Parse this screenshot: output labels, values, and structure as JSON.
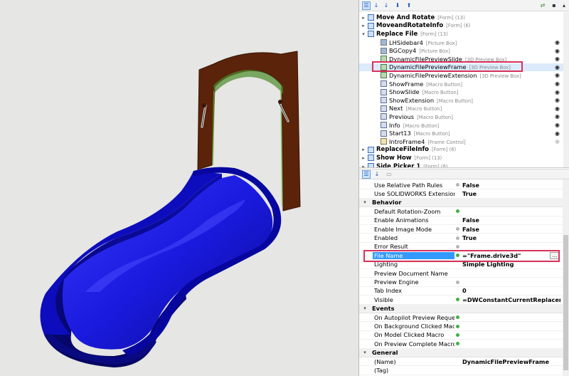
{
  "tree": {
    "rows": [
      {
        "label": "Move And Rotate",
        "type": "[Form] (13)",
        "level": 0,
        "exp": "▸",
        "icon": "form-icon",
        "bold": true
      },
      {
        "label": "MoveandRotateInfo",
        "type": "[Form] (6)",
        "level": 0,
        "exp": "▸",
        "icon": "form-icon",
        "bold": true
      },
      {
        "label": "Replace File",
        "type": "[Form] (13)",
        "level": 0,
        "exp": "▾",
        "icon": "form-icon",
        "bold": true
      },
      {
        "label": "LHSidebar4",
        "type": "[Picture Box]",
        "level": 1,
        "icon": "picture-box-icon",
        "eye": true,
        "lock": true
      },
      {
        "label": "BGCopy4",
        "type": "[Picture Box]",
        "level": 1,
        "icon": "picture-box-icon",
        "eye": true,
        "lock": true,
        "lock_dark": true
      },
      {
        "label": "DynamicFilePreviewSlide",
        "type": "[3D Preview Box]",
        "level": 1,
        "icon": "preview-box-icon",
        "eye": true,
        "lock": true
      },
      {
        "label": "DynamicFilePreviewFrame",
        "type": "[3D Preview Box]",
        "level": 1,
        "icon": "preview-box-icon",
        "eye": true,
        "lock": true,
        "selected": true
      },
      {
        "label": "DynamicFilePreviewExtension",
        "type": "[3D Preview Box]",
        "level": 1,
        "icon": "preview-box-icon",
        "eye": true,
        "lock": true
      },
      {
        "label": "ShowFrame",
        "type": "[Macro Button]",
        "level": 1,
        "icon": "macro-button-icon",
        "eye": true,
        "lock": true
      },
      {
        "label": "ShowSlide",
        "type": "[Macro Button]",
        "level": 1,
        "icon": "macro-button-icon",
        "eye": true,
        "lock": true
      },
      {
        "label": "ShowExtension",
        "type": "[Macro Button]",
        "level": 1,
        "icon": "macro-button-icon",
        "eye": true,
        "lock": true
      },
      {
        "label": "Next",
        "type": "[Macro Button]",
        "level": 1,
        "icon": "macro-button-icon",
        "eye": true,
        "lock": true
      },
      {
        "label": "Previous",
        "type": "[Macro Button]",
        "level": 1,
        "icon": "macro-button-icon",
        "eye": true,
        "lock": true
      },
      {
        "label": "Info",
        "type": "[Macro Button]",
        "level": 1,
        "icon": "macro-button-icon",
        "eye": true,
        "lock": true
      },
      {
        "label": "Start13",
        "type": "[Macro Button]",
        "level": 1,
        "icon": "macro-button-icon",
        "eye": true,
        "lock": true
      },
      {
        "label": "IntroFrame4",
        "type": "[Frame Control]",
        "level": 1,
        "icon": "frame-control-icon",
        "eye": true,
        "lock": true,
        "dim": true
      },
      {
        "label": "ReplaceFileInfo",
        "type": "[Form] (6)",
        "level": 0,
        "exp": "▸",
        "icon": "form-icon",
        "bold": true
      },
      {
        "label": "Show How",
        "type": "[Form] (13)",
        "level": 0,
        "exp": "▸",
        "icon": "form-icon",
        "bold": true
      },
      {
        "label": "Side Picker 1",
        "type": "[Form] (8)",
        "level": 0,
        "exp": "▸",
        "icon": "form-icon",
        "bold": true
      }
    ]
  },
  "properties": {
    "rows": [
      {
        "kind": "prop",
        "label": "Use Relative Path Rules",
        "value": "False",
        "dot": "gray"
      },
      {
        "kind": "prop",
        "label": "Use SOLIDWORKS Extension Suffix",
        "value": "True",
        "dot": "none"
      },
      {
        "kind": "cat",
        "label": "Behavior"
      },
      {
        "kind": "prop",
        "label": "Default Rotation-Zoom",
        "value": "",
        "dot": "green"
      },
      {
        "kind": "prop",
        "label": "Enable Animations",
        "value": "False",
        "dot": "none"
      },
      {
        "kind": "prop",
        "label": "Enable Image Mode",
        "value": "False",
        "dot": "gray"
      },
      {
        "kind": "prop",
        "label": "Enabled",
        "value": "True",
        "dot": "gray"
      },
      {
        "kind": "prop",
        "label": "Error Result",
        "value": "",
        "dot": "gray"
      },
      {
        "kind": "prop",
        "label": "File Name",
        "value": "=\"Frame.drive3d\"",
        "dot": "green",
        "selected": true
      },
      {
        "kind": "prop",
        "label": "Lighting",
        "value": "Simple Lighting",
        "dot": "none"
      },
      {
        "kind": "prop",
        "label": "Preview Document Name",
        "value": "",
        "dot": "none"
      },
      {
        "kind": "prop",
        "label": "Preview Engine",
        "value": "",
        "dot": "gray"
      },
      {
        "kind": "prop",
        "label": "Tab Index",
        "value": "0",
        "dot": "none"
      },
      {
        "kind": "prop",
        "label": "Visible",
        "value": "=DWConstantCurrentReplacement = '",
        "dot": "green"
      },
      {
        "kind": "cat",
        "label": "Events"
      },
      {
        "kind": "prop",
        "label": "On Autopilot Preview Requested Macro",
        "value": "",
        "dot": "green"
      },
      {
        "kind": "prop",
        "label": "On Background Clicked Macro",
        "value": "",
        "dot": "green"
      },
      {
        "kind": "prop",
        "label": "On Model Clicked Macro",
        "value": "",
        "dot": "green"
      },
      {
        "kind": "prop",
        "label": "On Preview Complete Macro",
        "value": "",
        "dot": "green"
      },
      {
        "kind": "cat",
        "label": "General"
      },
      {
        "kind": "prop",
        "label": "(Name)",
        "value": "DynamicFilePreviewFrame",
        "dot": "none"
      },
      {
        "kind": "prop",
        "label": "(Tag)",
        "value": "",
        "dot": "none"
      }
    ],
    "browse_button_label": "..."
  },
  "colors": {
    "slide": "#1010d8",
    "frame": "#5a230a",
    "highlight": "#d8315b",
    "selection": "#3399ff",
    "green_dot": "#42b043"
  }
}
